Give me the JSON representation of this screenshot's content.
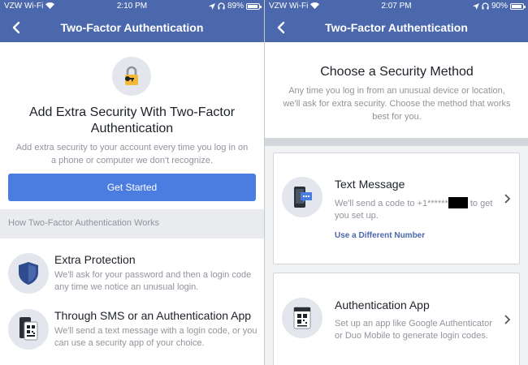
{
  "colors": {
    "header": "#4b68ad",
    "primary_button": "#4b7ce0",
    "link": "#4b68ad"
  },
  "left": {
    "status": {
      "carrier": "VZW Wi-Fi",
      "time": "2:10 PM",
      "battery": "89%",
      "battery_level": 0.89
    },
    "header_title": "Two-Factor Authentication",
    "hero_icon": "padlock-key-icon",
    "heading": "Add Extra Security With Two-Factor Authentication",
    "subtext": "Add extra security to your account every time you log in on a phone or computer we don't recognize.",
    "cta_label": "Get Started",
    "section_header": "How Two-Factor Authentication Works",
    "features": [
      {
        "icon": "shield-icon",
        "title": "Extra Protection",
        "desc": "We'll ask for your password and then a login code any time we notice an unusual login."
      },
      {
        "icon": "phone-qr-icon",
        "title": "Through SMS or an Authentication App",
        "desc": "We'll send a text message with a login code, or you can use a security app of your choice."
      }
    ]
  },
  "right": {
    "status": {
      "carrier": "VZW Wi-Fi",
      "time": "2:07 PM",
      "battery": "90%",
      "battery_level": 0.9
    },
    "header_title": "Two-Factor Authentication",
    "heading": "Choose a Security Method",
    "subtext": "Any time you log in from an unusual device or location, we'll ask for extra security. Choose the method that works best for you.",
    "methods": [
      {
        "icon": "phone-message-icon",
        "title": "Text Message",
        "desc_prefix": "We'll send a code to +1******",
        "desc_suffix": " to get you set up.",
        "link": "Use a Different Number"
      },
      {
        "icon": "qr-app-icon",
        "title": "Authentication App",
        "desc": "Set up an app like Google Authenticator or Duo Mobile to generate login codes."
      }
    ]
  }
}
